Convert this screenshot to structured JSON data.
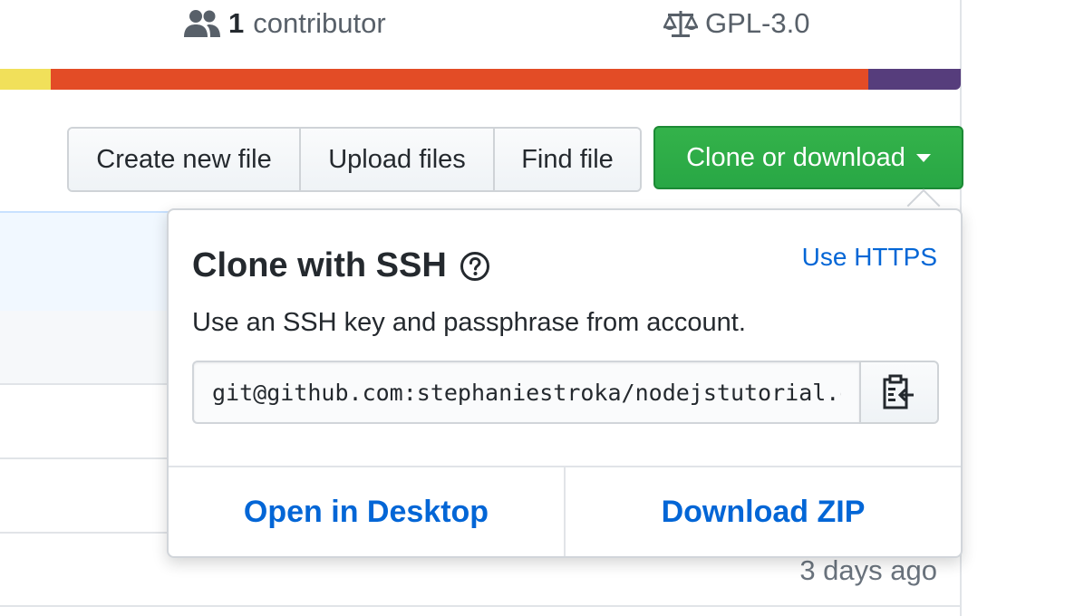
{
  "summary": {
    "contributors_count": "1",
    "contributors_label": "contributor",
    "license": "GPL-3.0",
    "contributors_icon": "people-icon",
    "license_icon": "law-scale-icon"
  },
  "language_bar": {
    "segments": [
      {
        "color": "#f1e05a",
        "share": 0.053
      },
      {
        "color": "#e34c26",
        "share": 0.851
      },
      {
        "color": "#563d7c",
        "share": 0.096
      }
    ]
  },
  "toolbar": {
    "create_new_file": "Create new file",
    "upload_files": "Upload files",
    "find_file": "Find file",
    "clone_or_download": "Clone or download"
  },
  "clone_popover": {
    "title": "Clone with SSH",
    "help_icon": "question-circle-icon",
    "use_https": "Use HTTPS",
    "description": "Use an SSH key and passphrase from account.",
    "url_value": "git@github.com:stephaniestroka/nodejstutorial.git",
    "copy_icon": "clipboard-icon",
    "open_in_desktop": "Open in Desktop",
    "download_zip": "Download ZIP"
  },
  "file_list": {
    "last_updated": "3 days ago"
  },
  "colors": {
    "primary_green": "#28a745",
    "link_blue": "#0366d6",
    "text": "#24292e",
    "muted": "#586069"
  }
}
